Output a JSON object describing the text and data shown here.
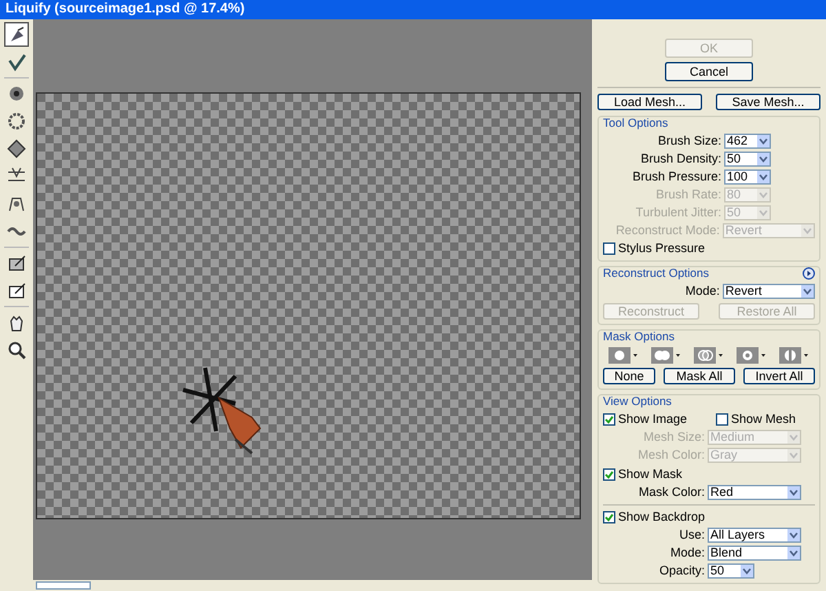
{
  "window": {
    "title": "Liquify (sourceimage1.psd @ 17.4%)"
  },
  "tools": [
    {
      "selected": true
    },
    {
      "selected": false
    },
    {
      "selected": false
    },
    {
      "selected": false
    },
    {
      "selected": false
    },
    {
      "selected": false
    },
    {
      "selected": false
    },
    {
      "selected": false
    },
    {
      "selected": false
    },
    {
      "selected": false
    },
    {
      "selected": false
    },
    {
      "selected": false
    }
  ],
  "dialog_buttons": [
    {
      "label": "OK",
      "disabled": true
    },
    {
      "label": "Cancel",
      "disabled": false
    }
  ],
  "mesh_buttons": [
    {
      "label": "Load Mesh..."
    },
    {
      "label": "Save Mesh..."
    }
  ],
  "tool_options": {
    "title": "Tool Options",
    "fields": [
      {
        "label": "Brush Size:",
        "value": "462",
        "disabled": false,
        "kind": "short"
      },
      {
        "label": "Brush Density:",
        "value": "50",
        "disabled": false,
        "kind": "short"
      },
      {
        "label": "Brush Pressure:",
        "value": "100",
        "disabled": false,
        "kind": "short"
      },
      {
        "label": "Brush Rate:",
        "value": "80",
        "disabled": true,
        "kind": "short"
      },
      {
        "label": "Turbulent Jitter:",
        "value": "50",
        "disabled": true,
        "kind": "short"
      },
      {
        "label": "Reconstruct Mode:",
        "value": "Revert",
        "disabled": true,
        "kind": "wide"
      }
    ],
    "stylus_pressure": {
      "label": "Stylus Pressure",
      "checked": false
    }
  },
  "reconstruct_options": {
    "title": "Reconstruct Options",
    "mode": {
      "label": "Mode:",
      "value": "Revert"
    },
    "buttons": [
      {
        "label": "Reconstruct",
        "disabled": true
      },
      {
        "label": "Restore All",
        "disabled": true
      }
    ]
  },
  "mask_options": {
    "title": "Mask Options",
    "buttons": [
      {
        "label": "None"
      },
      {
        "label": "Mask All"
      },
      {
        "label": "Invert All"
      }
    ]
  },
  "view_options": {
    "title": "View Options",
    "show_image": {
      "label": "Show Image",
      "checked": true
    },
    "show_mesh": {
      "label": "Show Mesh",
      "checked": false
    },
    "mesh_fields": [
      {
        "label": "Mesh Size:",
        "value": "Medium",
        "disabled": true
      },
      {
        "label": "Mesh Color:",
        "value": "Gray",
        "disabled": true
      }
    ],
    "show_mask": {
      "label": "Show Mask",
      "checked": true
    },
    "mask_fields": [
      {
        "label": "Mask Color:",
        "value": "Red",
        "disabled": false
      }
    ],
    "show_backdrop": {
      "label": "Show Backdrop",
      "checked": true
    },
    "backdrop_fields": [
      {
        "label": "Use:",
        "value": "All Layers",
        "disabled": false,
        "kind": "wide"
      },
      {
        "label": "Mode:",
        "value": "Blend",
        "disabled": false,
        "kind": "wide"
      },
      {
        "label": "Opacity:",
        "value": "50",
        "disabled": false,
        "kind": "short"
      }
    ]
  }
}
